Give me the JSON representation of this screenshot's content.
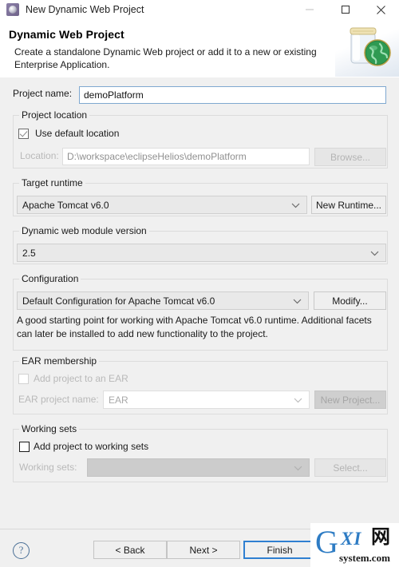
{
  "window": {
    "title": "New Dynamic Web Project",
    "icon": "eclipse-wizard-icon",
    "minimize_label": "—",
    "maximize_label": "□",
    "close_label": "✕"
  },
  "header": {
    "title": "Dynamic Web Project",
    "description": "Create a standalone Dynamic Web project or add it to a new or existing Enterprise Application.",
    "banner_icon": "war-jar-globe-icon"
  },
  "project_name": {
    "label": "Project name:",
    "value": "demoPlatform",
    "placeholder": ""
  },
  "project_location": {
    "group_title": "Project location",
    "use_default_label": "Use default location",
    "use_default_checked": true,
    "location_label": "Location:",
    "location_value": "D:\\workspace\\eclipseHelios\\demoPlatform",
    "browse_label": "Browse..."
  },
  "target_runtime": {
    "group_title": "Target runtime",
    "value": "Apache Tomcat v6.0",
    "new_runtime_label": "New Runtime..."
  },
  "module_version": {
    "group_title": "Dynamic web module version",
    "value": "2.5"
  },
  "configuration": {
    "group_title": "Configuration",
    "value": "Default Configuration for Apache Tomcat v6.0",
    "modify_label": "Modify...",
    "description": "A good starting point for working with Apache Tomcat v6.0 runtime. Additional facets can later be installed to add new functionality to the project."
  },
  "ear_membership": {
    "group_title": "EAR membership",
    "add_to_ear_label": "Add project to an EAR",
    "add_to_ear_checked": false,
    "ear_project_name_label": "EAR project name:",
    "ear_project_name_value": "EAR",
    "new_project_label": "New Project..."
  },
  "working_sets": {
    "group_title": "Working sets",
    "add_to_working_sets_label": "Add project to working sets",
    "add_to_working_sets_checked": false,
    "working_sets_label": "Working sets:",
    "working_sets_value": "",
    "select_label": "Select..."
  },
  "footer": {
    "help_label": "?",
    "back_label": "< Back",
    "next_label": "Next >",
    "finish_label": "Finish"
  },
  "watermark": {
    "g": "G",
    "xi": "XI",
    "cjk": "网",
    "sub": "system.com"
  },
  "colors": {
    "dialog_background": "#f0f0f0",
    "focus_blue": "#2f7fd1",
    "field_border_focus": "#7fa8d0",
    "disabled_text": "#b9b9b9",
    "watermark_blue": "#2e7cc4"
  }
}
